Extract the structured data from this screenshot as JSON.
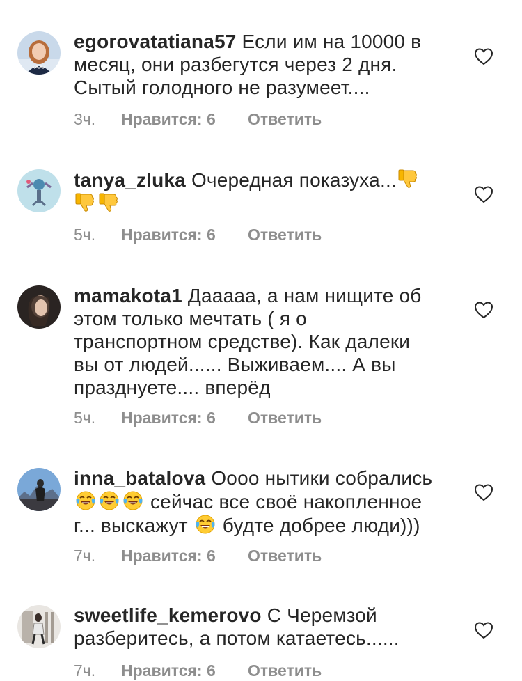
{
  "comments": [
    {
      "username": "egorovatatiana57",
      "text_lines": [
        "Если им на 10000 в",
        "месяц, они разбегутся через 2 дня.",
        "Сытый голодного не разумеет...."
      ],
      "time": "3ч.",
      "likes": "Нравится: 6",
      "reply": "Ответить"
    },
    {
      "username": "tanya_zluka",
      "text": "Очередная показуха...",
      "emoji": "thumbs-down-icon",
      "time": "5ч.",
      "likes": "Нравится: 6",
      "reply": "Ответить"
    },
    {
      "username": "mamakota1",
      "text_lines": [
        "Даааaa, а нам нищите об",
        "этом только мечтать ( я о",
        "транспортном средстве). Как далеки",
        "вы от людей...... Выживаем.... А вы",
        "празднуете.... вперёд"
      ],
      "time": "5ч.",
      "likes": "Нравится: 6",
      "reply": "Ответить"
    },
    {
      "username": "inna_batalova",
      "text_parts": [
        "Оооо нытики собрались",
        "сейчас все своё накопленное",
        "г... выскажут",
        "будте добрее люди)))"
      ],
      "emoji": "tears-of-joy-icon",
      "time": "7ч.",
      "likes": "Нравится: 6",
      "reply": "Ответить"
    },
    {
      "username": "sweetlife_kemerovo",
      "text_lines": [
        "С Черемзой",
        "разберитесь, а потом катаетесь......"
      ],
      "time": "7ч.",
      "likes": "Нравится: 6",
      "reply": "Ответить"
    }
  ]
}
